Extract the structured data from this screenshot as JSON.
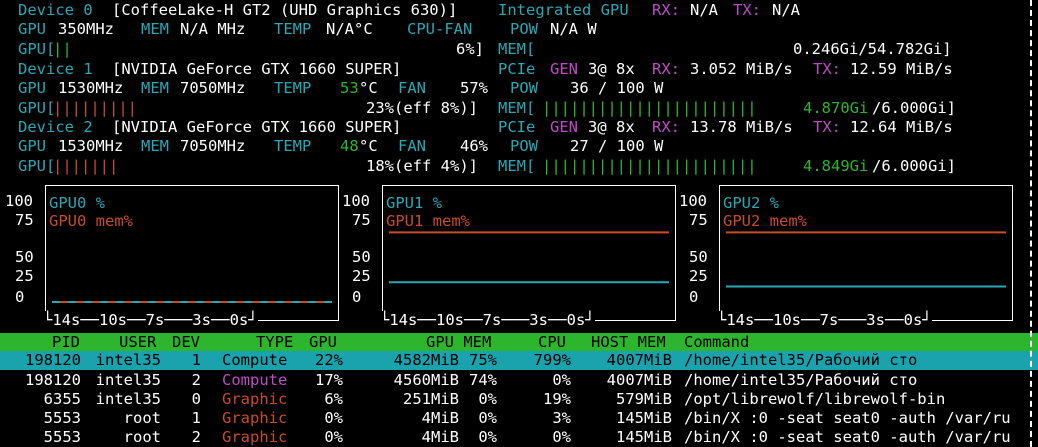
{
  "devices": [
    {
      "line1": {
        "label": "Device 0",
        "name": "[CoffeeLake-H GT2 (UHD Graphics 630)]",
        "type": "Integrated GPU",
        "rx_label": "RX:",
        "rx": "N/A",
        "tx_label": "TX:",
        "tx": "N/A"
      },
      "line2": {
        "gpu_label": "GPU",
        "gpu_clock": "350MHz",
        "mem_label": "MEM",
        "mem_clock": "N/A MHz",
        "temp_label": "TEMP",
        "temp": "N/A°C",
        "fan_label": "CPU-FAN",
        "pow_label": "POW",
        "pow": "N/A W"
      },
      "line3": {
        "gpu_bar_label": "GPU[",
        "gpu_bar": "||",
        "gpu_pct": "6%]",
        "mem_bar_label": "MEM[",
        "mem_bar": "",
        "mem_text": "0.246Gi/54.782Gi]"
      }
    },
    {
      "line1": {
        "label": "Device 1",
        "name": "[NVIDIA GeForce GTX 1660 SUPER]",
        "pcie_label": "PCIe",
        "gen_label": "GEN",
        "gen": "3@ 8x",
        "rx_label": "RX:",
        "rx": "3.052 MiB/s",
        "tx_label": "TX:",
        "tx": "12.59 MiB/s"
      },
      "line2": {
        "gpu_label": "GPU",
        "gpu_clock": "1530MHz",
        "mem_label": "MEM",
        "mem_clock": "7050MHz",
        "temp_label": "TEMP",
        "temp": "53",
        "temp_unit": "°C",
        "fan_label": "FAN",
        "fan": "57%",
        "pow_label": "POW",
        "pow": "36 / 100 W"
      },
      "line3": {
        "gpu_bar_label": "GPU[",
        "gpu_bar": "|||||||||",
        "gpu_pct": "23%(eff 8%)]",
        "mem_bar_label": "MEM[",
        "mem_bar": "|||||||||||||||||||||||",
        "mem_used": "4.870Gi",
        "mem_total": "/6.000Gi]"
      }
    },
    {
      "line1": {
        "label": "Device 2",
        "name": "[NVIDIA GeForce GTX 1660 SUPER]",
        "pcie_label": "PCIe",
        "gen_label": "GEN",
        "gen": "3@ 8x",
        "rx_label": "RX:",
        "rx": "13.78 MiB/s",
        "tx_label": "TX:",
        "tx": "12.64 MiB/s"
      },
      "line2": {
        "gpu_label": "GPU",
        "gpu_clock": "1530MHz",
        "mem_label": "MEM",
        "mem_clock": "7050MHz",
        "temp_label": "TEMP",
        "temp": "48",
        "temp_unit": "°C",
        "fan_label": "FAN",
        "fan": "46%",
        "pow_label": "POW",
        "pow": "27 / 100 W"
      },
      "line3": {
        "gpu_bar_label": "GPU[",
        "gpu_bar": "|||||||",
        "gpu_pct": "18%(eff 4%)]",
        "mem_bar_label": "MEM[",
        "mem_bar": "|||||||||||||||||||||||",
        "mem_used": "4.849Gi",
        "mem_total": "/6.000Gi]"
      }
    }
  ],
  "graphs": {
    "y_ticks": [
      "100",
      "75",
      "50",
      "25",
      "0"
    ],
    "x_ticks": [
      "14s",
      "10s",
      "7s",
      "3s",
      "0s"
    ],
    "panes": [
      {
        "util_label": "GPU0 %",
        "mem_label": "GPU0 mem%",
        "util_value": 6,
        "mem_value": 0
      },
      {
        "util_label": "GPU1 %",
        "mem_label": "GPU1 mem%",
        "util_value": 23,
        "mem_value": 81
      },
      {
        "util_label": "GPU2 %",
        "mem_label": "GPU2 mem%",
        "util_value": 18,
        "mem_value": 81
      }
    ]
  },
  "colors": {
    "cyan": "#2aa7b5",
    "magenta": "#c04bc8",
    "green": "#2db52d",
    "orange": "#c84b2a",
    "selected_row": "#1aa3ad"
  },
  "process_table": {
    "headers": [
      "PID",
      "USER",
      "DEV",
      "TYPE",
      "GPU",
      "GPU MEM",
      "CPU",
      "HOST MEM",
      "Command"
    ],
    "rows": [
      [
        "198120",
        "intel35",
        "1",
        "Compute",
        "22%",
        "4582MiB",
        "75%",
        "799%",
        "4007MiB",
        "/home/intel35/Рабочий сто"
      ],
      [
        "198120",
        "intel35",
        "2",
        "Compute",
        "17%",
        "4560MiB",
        "74%",
        "0%",
        "4007MiB",
        "/home/intel35/Рабочий сто"
      ],
      [
        "6355",
        "intel35",
        "0",
        "Graphic",
        "6%",
        "251MiB",
        "0%",
        "19%",
        "579MiB",
        "/opt/librewolf/librewolf-bin"
      ],
      [
        "5553",
        "root",
        "1",
        "Graphic",
        "0%",
        "4MiB",
        "0%",
        "3%",
        "145MiB",
        "/bin/X :0 -seat seat0 -auth /var/ru"
      ],
      [
        "5553",
        "root",
        "2",
        "Graphic",
        "0%",
        "4MiB",
        "0%",
        "0%",
        "145MiB",
        "/bin/X :0 -seat seat0 -auth /var/ru"
      ]
    ]
  }
}
